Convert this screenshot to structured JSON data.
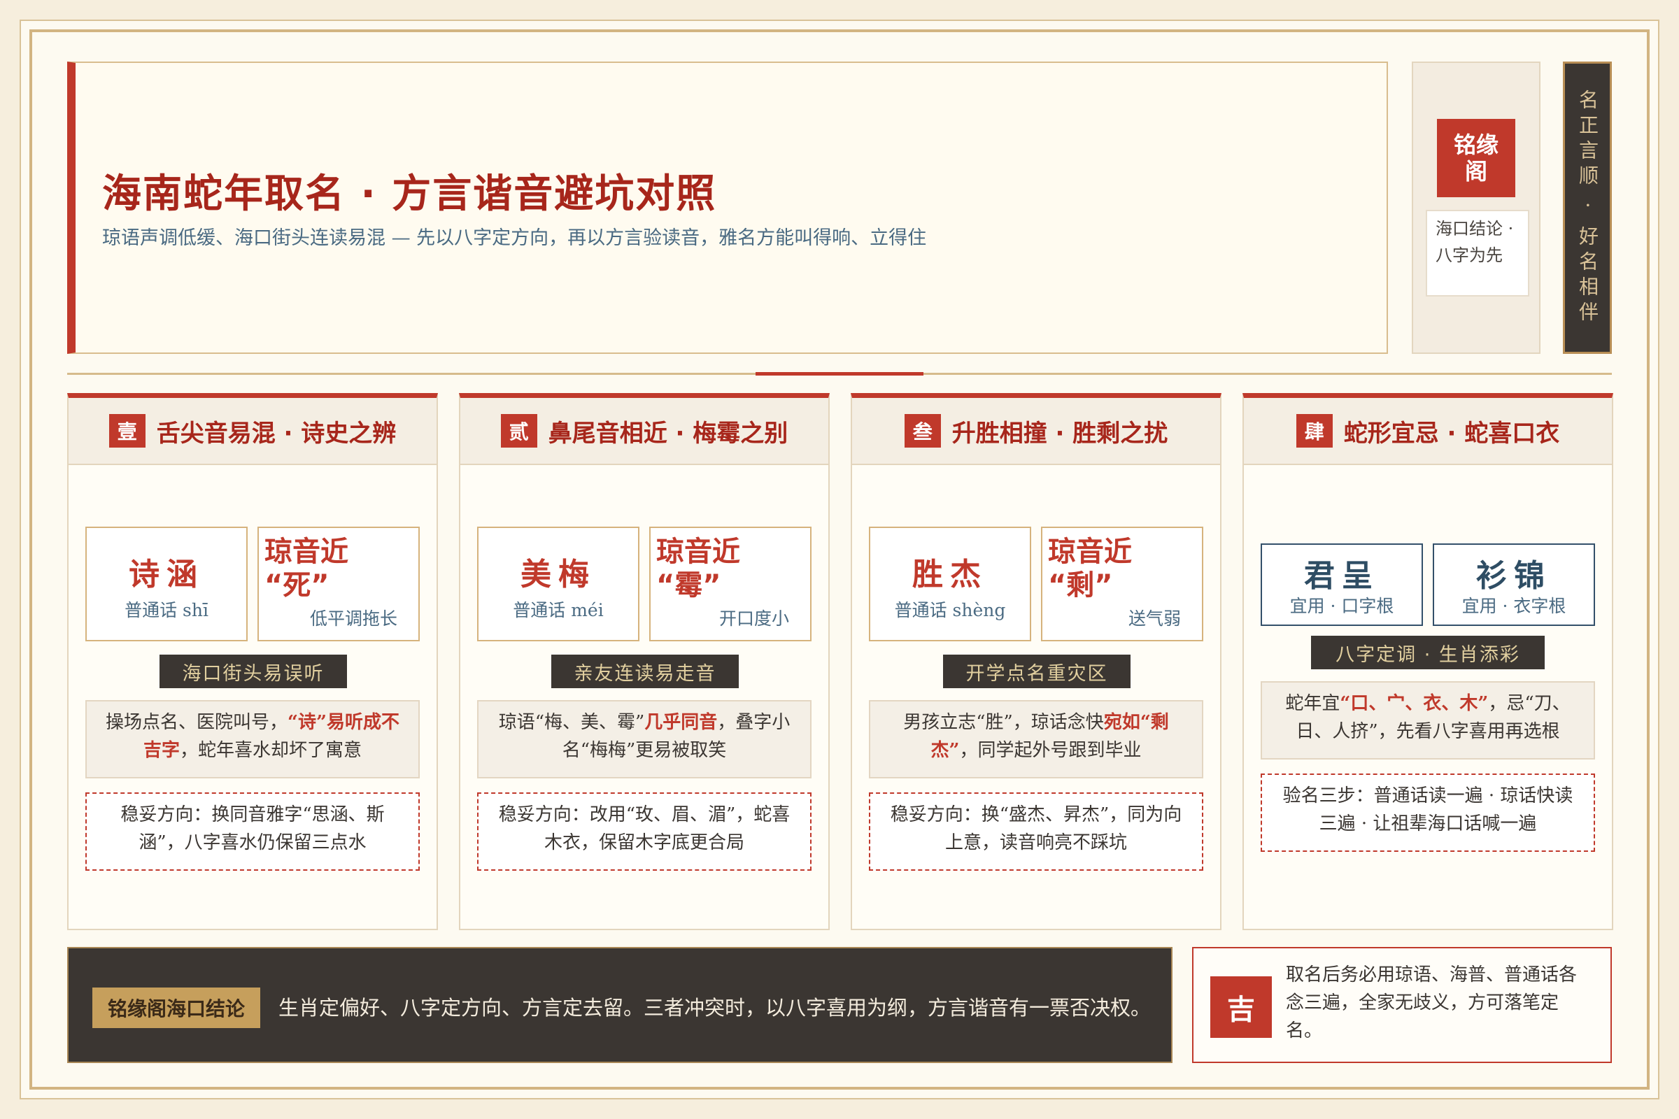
{
  "header": {
    "title": "海南蛇年取名 · 方言谐音避坑对照",
    "subtitle": "琼语声调低缓、海口街头连读易混 — 先以八字定方向，再以方言验读音，雅名方能叫得响、立得住"
  },
  "brand": {
    "seal_line1": "铭缘",
    "seal_line2": "阁",
    "note": "海口结论 · 八字为先",
    "motto": "名正言顺 · 好名相伴"
  },
  "cards": [
    {
      "badge": "壹",
      "title": "舌尖音易混 · 诗史之辨",
      "name": "诗涵",
      "pinyin": "普通话 shī",
      "warn_line1": "琼音近",
      "warn_line2": "“死”",
      "warn_note": "低平调拖长",
      "tag": "海口街头易误听",
      "info_pre": "操场点名、医院叫号，",
      "info_hl": "“诗”易听成不吉字",
      "info_post": "，蛇年喜水却坏了寓意",
      "tip": "稳妥方向：换同音雅字“思涵、斯涵”，八字喜水仍保留三点水"
    },
    {
      "badge": "贰",
      "title": "鼻尾音相近 · 梅霉之别",
      "name": "美梅",
      "pinyin": "普通话 méi",
      "warn_line1": "琼音近",
      "warn_line2": "“霉”",
      "warn_note": "开口度小",
      "tag": "亲友连读易走音",
      "info_pre": "琼语“梅、美、霉”",
      "info_hl": "几乎同音",
      "info_post": "，叠字小名“梅梅”更易被取笑",
      "tip": "稳妥方向：改用“玫、眉、湄”，蛇喜木衣，保留木字底更合局"
    },
    {
      "badge": "叁",
      "title": "升胜相撞 · 胜剩之扰",
      "name": "胜杰",
      "pinyin": "普通话 shèng",
      "warn_line1": "琼音近",
      "warn_line2": "“剩”",
      "warn_note": "送气弱",
      "tag": "开学点名重灾区",
      "info_pre": "男孩立志“胜”，琼话念快",
      "info_hl": "宛如“剩杰”",
      "info_post": "，同学起外号跟到毕业",
      "tip": "稳妥方向：换“盛杰、昇杰”，同为向上意，读音响亮不踩坑"
    },
    {
      "badge": "肆",
      "title": "蛇形宜忌 · 蛇喜口衣",
      "ok1_name": "君呈",
      "ok1_note": "宜用 · 口字根",
      "ok2_name": "衫锦",
      "ok2_note": "宜用 · 衣字根",
      "tag": "八字定调 · 生肖添彩",
      "info_pre": "蛇年宜",
      "info_hl": "“口、宀、衣、木”",
      "info_post": "，忌“刀、日、人挤”，先看八字喜用再选根",
      "tip": "验名三步：普通话读一遍 · 琼话快读三遍 · 让祖辈海口话喊一遍"
    }
  ],
  "footer": {
    "tag": "铭缘阁海口结论",
    "text": "生肖定偏好、八字定方向、方言定去留。三者冲突时，以八字喜用为纲，方言谐音有一票否决权。",
    "seal": "吉",
    "side_text": "取名后务必用琼语、海普、普通话各念三遍，全家无歧义，方可落笔定名。"
  },
  "colors": {
    "accent": "#c0392b",
    "dark": "#3b3632",
    "gold": "#c69f5c"
  }
}
